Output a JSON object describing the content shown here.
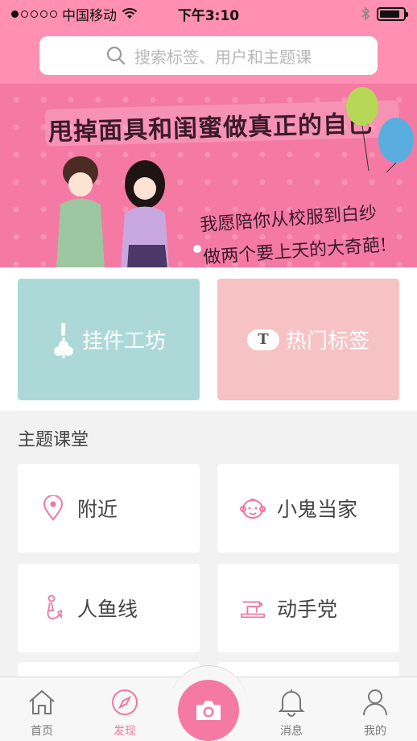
{
  "status_bar": {
    "carrier": "中国移动",
    "time": "下午3:10",
    "signal_bars_filled": 1,
    "battery_level": 0.85
  },
  "search": {
    "placeholder": "搜索标签、用户和主题课"
  },
  "banner": {
    "title": "甩掉面具和闺蜜做真正的自己",
    "line1": "我愿陪你从校服到白纱",
    "line2": "做两个要上天的大奇葩!"
  },
  "quick_actions": [
    {
      "label": "挂件工坊",
      "icon": "pendant-icon",
      "color": "#acd9d8"
    },
    {
      "label": "热门标签",
      "icon": "t-badge-icon",
      "badge": "T",
      "color": "#f6c2c4"
    }
  ],
  "topics_section": {
    "title": "主题课堂",
    "items": [
      {
        "label": "附近",
        "icon": "location-pin-icon"
      },
      {
        "label": "小鬼当家",
        "icon": "baby-face-icon"
      },
      {
        "label": "人鱼线",
        "icon": "mermaid-icon"
      },
      {
        "label": "动手党",
        "icon": "sewing-machine-icon"
      }
    ]
  },
  "tab_bar": {
    "tabs": [
      {
        "label": "首页",
        "icon": "home-icon",
        "active": false
      },
      {
        "label": "发现",
        "icon": "compass-icon",
        "active": true
      },
      {
        "label": "消息",
        "icon": "bell-icon",
        "active": false
      },
      {
        "label": "我的",
        "icon": "user-icon",
        "active": false
      }
    ],
    "center_icon": "camera-icon"
  },
  "colors": {
    "accent": "#ff8fb3",
    "accent_dark": "#f57aa3",
    "active_tab": "#f0789f"
  }
}
